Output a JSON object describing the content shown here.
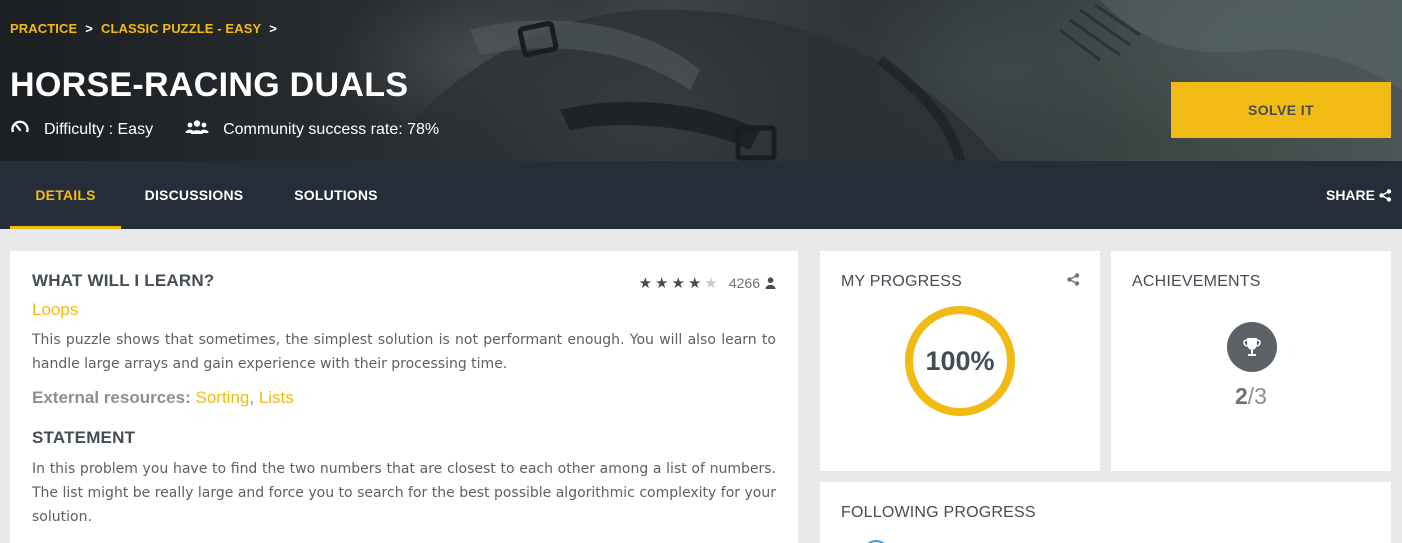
{
  "breadcrumb": {
    "practice": "PRACTICE",
    "category": "CLASSIC PUZZLE - EASY"
  },
  "puzzle": {
    "title": "HORSE-RACING DUALS",
    "difficulty": "Difficulty : Easy",
    "success_rate": "Community success rate: 78%",
    "solve_label": "SOLVE IT"
  },
  "tabs": [
    {
      "label": "DETAILS",
      "active": true
    },
    {
      "label": "DISCUSSIONS",
      "active": false
    },
    {
      "label": "SOLUTIONS",
      "active": false
    }
  ],
  "share_label": "SHARE",
  "learn": {
    "heading": "WHAT WILL I LEARN?",
    "rating_stars": 4,
    "rating_max": 5,
    "votes": "4266",
    "topic": "Loops",
    "description": "This puzzle shows that sometimes, the simplest solution is not performant enough. You will also learn to handle large arrays and gain experience with their processing time.",
    "external_label": "External resources:",
    "resources": [
      "Sorting",
      "Lists"
    ]
  },
  "statement": {
    "heading": "STATEMENT",
    "text": "In this problem you have to find the two numbers that are closest to each other among a list of numbers. The list might be really large and force you to search for the best possible algorithmic complexity for your solution."
  },
  "progress": {
    "label": "MY PROGRESS",
    "value": "100%",
    "fraction": 1.0
  },
  "achievements": {
    "label": "ACHIEVEMENTS",
    "earned": "2",
    "total": "/3"
  },
  "following": {
    "label": "FOLLOWING PROGRESS"
  },
  "colors": {
    "accent": "#f2bb13",
    "nav": "#252e38",
    "text": "#454c55",
    "page_bg": "#e7e9eb"
  },
  "icons": [
    "speedometer-icon",
    "community-icon",
    "share-icon",
    "star-icon",
    "user-icon",
    "trophy-icon",
    "chevron-right-icon"
  ]
}
